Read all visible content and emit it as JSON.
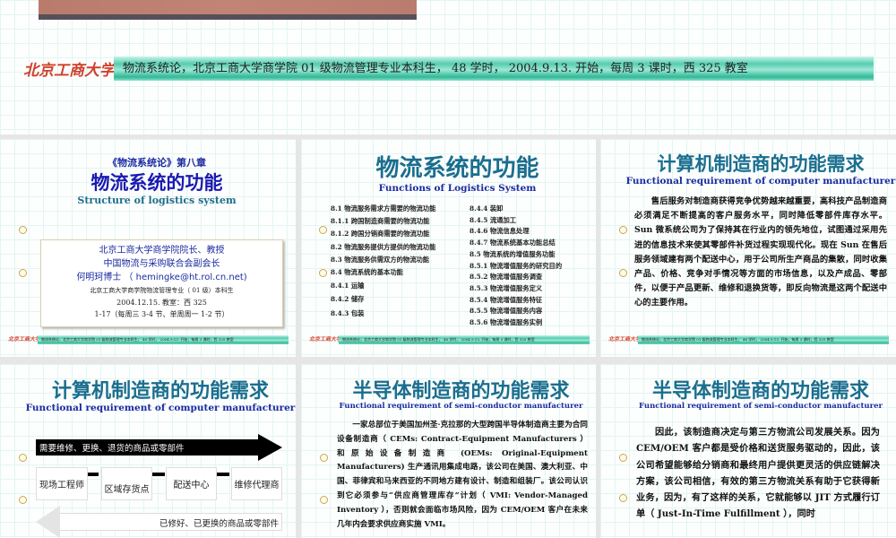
{
  "top_slide": {
    "logo": "北京工商大学",
    "banner": "物流系统论，北京工商大学商学院 01 级物流管理专业本科生， 48 学时， 2004.9.13. 开始，每周 3 课时，西 325 教室"
  },
  "footer": {
    "logo": "北京工商大学",
    "banner": "物流系统论，北京工商大学商学院 01 级物流管理专业本科生， 48 学时， 2004.9.13. 开始，每周 3 课时，西 325 教室"
  },
  "slide1": {
    "chapter": "《物流系统论》第八章",
    "title": "物流系统的功能",
    "subtitle": "Structure of logistics system",
    "info": [
      "北京工商大学商学院院长、教授",
      "中国物流与采购联合会副会长",
      "何明珂博士 （ hemingke@ht.rol.cn.net)",
      "北京工商大学商学院物流管理专业（ 01 级）本科生",
      "2004.12.15.      教室：西 325",
      "1-17（每周三 3-4 节、单周周一 1-2 节）"
    ]
  },
  "slide2": {
    "title": "物流系统的功能",
    "subtitle": "Functions of Logistics System",
    "toc_left": [
      "8.1  物流服务需求方需要的物流功能",
      "8.1.1  跨国制造商需要的物流功能",
      "8.1.2  跨国分销商需要的物流功能",
      "8.2  物流服务提供方提供的物流功能",
      "8.3  物流服务供需双方的物流功能",
      "8.4  物流系统的基本功能",
      "8.4.1  运输",
      "8.4.2  储存",
      "8.4.3  包装"
    ],
    "toc_right": [
      "8.4.4  装卸",
      "8.4.5  流通加工",
      "8.4.6  物流信息处理",
      "8.4.7  物流系统基本功能总结",
      "8.5  物流系统的增值服务功能",
      "8.5.1  物流增值服务的研究目的",
      "8.5.2  物流增值服务调查",
      "8.5.3  物流增值服务定义",
      "8.5.4  物流增值服务特征",
      "8.5.5  物流增值服务内容",
      "8.5.6  物流增值服务实例"
    ]
  },
  "slide3": {
    "title": "计算机制造商的功能需求",
    "subtitle": "Functional requirement of computer manufacturer",
    "body": "　　售后服务对制造商获得竞争优势越来越重要，高科技产品制造商必须满足不断提高的客户服务水平，同时降低零部件库存水平。 Sun 微系统公司为了保持其在行业内的领先地位，试图通过采用先进的信息技术来使其零部件补货过程实现现代化。现在 Sun 在售后服务领域建有两个配送中心，用于公司所生产商品的集散，同时收集产品、价格、竞争对手情况等方面的市场信息，以及产成品、零部件，以便于产品更新、维修和退换货等，即反向物流是这两个配送中心的主要作用。"
  },
  "slide4": {
    "title": "计算机制造商的功能需求",
    "subtitle": "Functional requirement of computer manufacturer",
    "forward_arrow": "需要维修、更换、退货的商品或零部件",
    "nodes": [
      "现场工程师",
      "区域存货点",
      "配送中心",
      "维修代理商"
    ],
    "return_arrow": "已修好、已更换的商品或零部件"
  },
  "slide5": {
    "title": "半导体制造商的功能需求",
    "subtitle": "Functional requirement of semi-conductor manufacturer",
    "body": "　　一家总部位于美国加州圣·克拉那的大型跨国半导体制造商主要为合同设备制造商（ CEMs: Contract-Equipment Manufacturers ）和原始设备制造商 (OEMs: Original-Equipment Manufacturers) 生产通讯用集成电路，该公司在美国、澳大利亚、中国、菲律宾和马来西亚的不同地方建有设计、制造和组装厂。该公司认识到它必须参与“供应商管理库存”计划（ VMI: Vendor-Managed Inventory ），否则就会面临市场风险，因为 CEM/OEM 客户在未来几年内会要求供应商实施 VMI。"
  },
  "slide6": {
    "title": "半导体制造商的功能需求",
    "subtitle": "Functional requirement of semi-conductor manufacturer",
    "body": "　　因此，该制造商决定与第三方物流公司发展关系。因为 CEM/OEM 客户都是受价格和送货服务驱动的，因此，该公司希望能够给分销商和最终用户提供更灵活的供应链解决方案，该公司相信，有效的第三方物流关系有助于它获得新业务，因为，有了这样的关系，它就能够以 JIT 方式履行订单（ Just-In-Time Fulfillment ），同时"
  },
  "colors": {
    "title_teal": "#1a6e8e",
    "subtitle_blue": "#1a2aa0",
    "banner_green": "#3cc4a2",
    "logo_red": "#d0402a"
  }
}
